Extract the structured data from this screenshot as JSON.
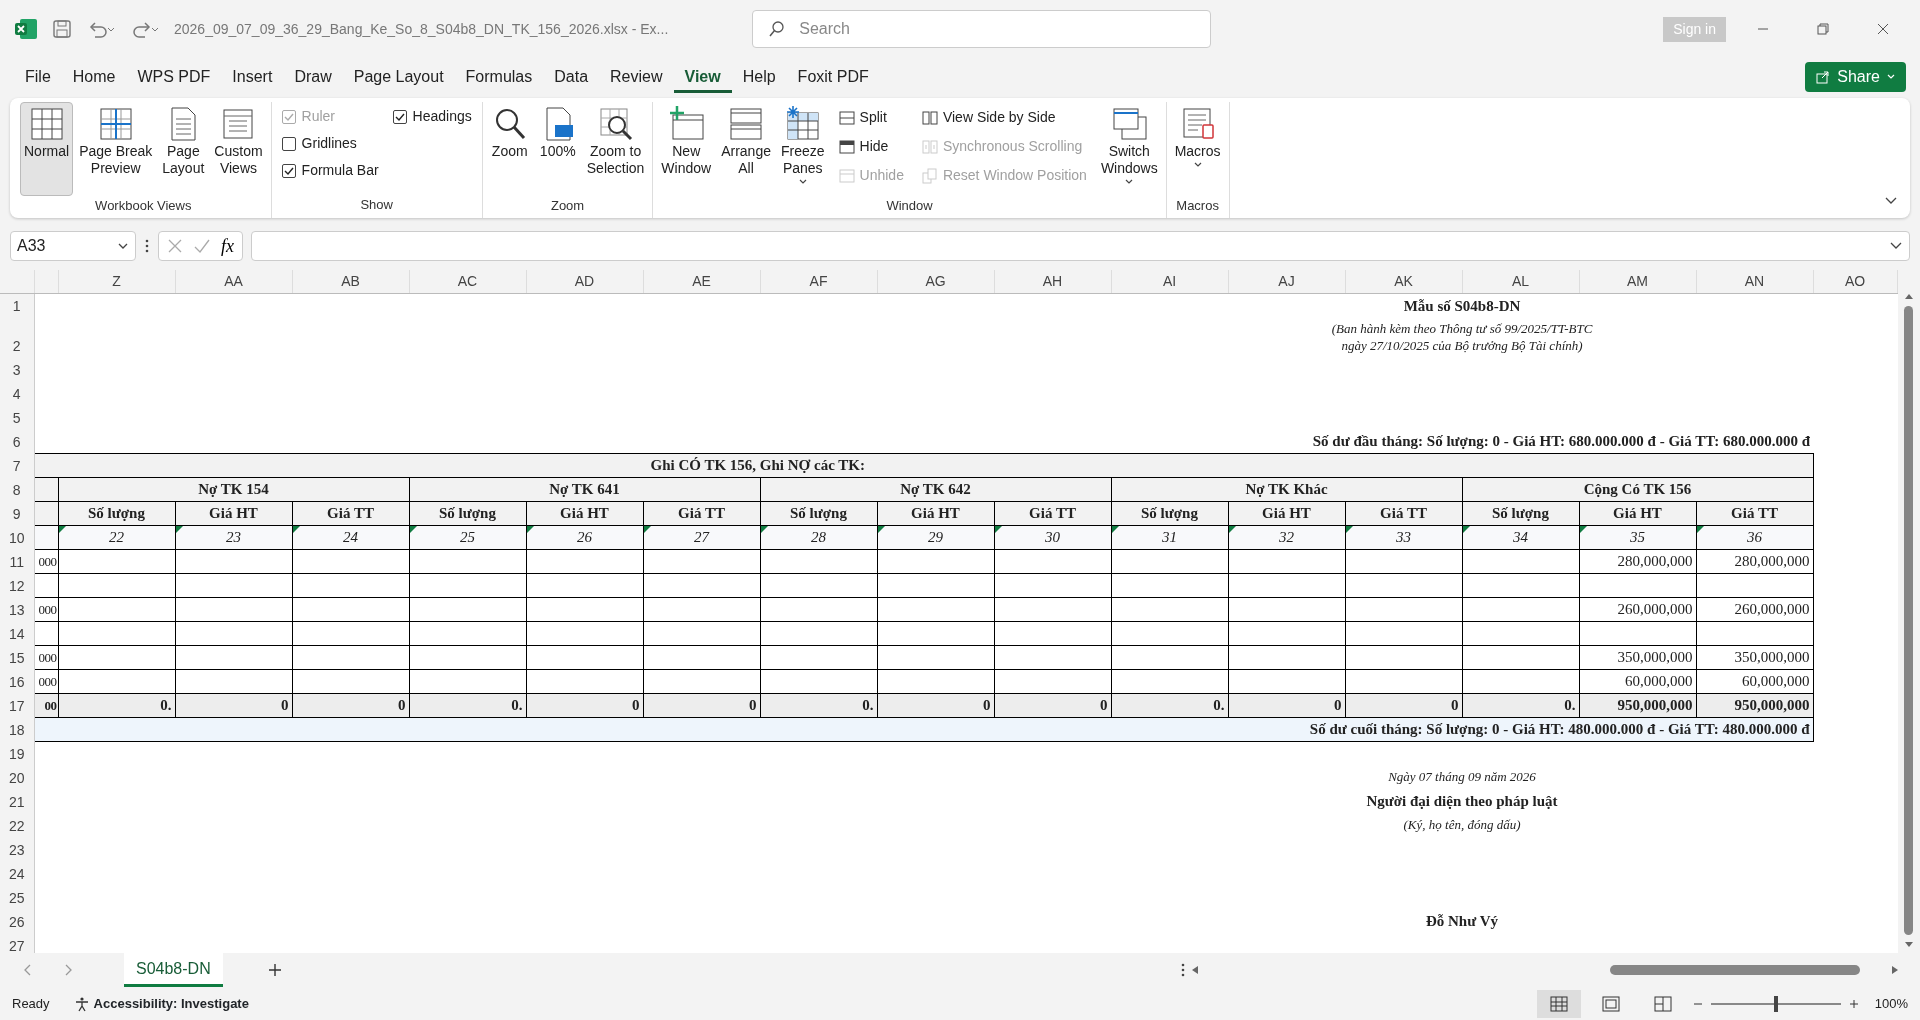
{
  "window": {
    "title": "2026_09_07_09_36_29_Bang_Ke_So_8_S04b8_DN_TK_156_2026.xlsx  -  Ex...",
    "search_placeholder": "Search",
    "sign_in": "Sign in",
    "share": "Share"
  },
  "menu_tabs": [
    {
      "label": "File",
      "selected": false
    },
    {
      "label": "Home",
      "selected": false
    },
    {
      "label": "WPS PDF",
      "selected": false
    },
    {
      "label": "Insert",
      "selected": false
    },
    {
      "label": "Draw",
      "selected": false
    },
    {
      "label": "Page Layout",
      "selected": false
    },
    {
      "label": "Formulas",
      "selected": false
    },
    {
      "label": "Data",
      "selected": false
    },
    {
      "label": "Review",
      "selected": false
    },
    {
      "label": "View",
      "selected": true
    },
    {
      "label": "Help",
      "selected": false
    },
    {
      "label": "Foxit PDF",
      "selected": false
    }
  ],
  "ribbon": [
    {
      "label": "Workbook Views",
      "items": [
        {
          "kind": "large",
          "label": "Normal",
          "selected": true
        },
        {
          "kind": "large",
          "label": "Page Break\nPreview",
          "selected": false
        },
        {
          "kind": "large",
          "label": "Page\nLayout",
          "selected": false
        },
        {
          "kind": "large",
          "label": "Custom\nViews",
          "selected": false
        }
      ]
    },
    {
      "label": "Show",
      "items": [
        {
          "kind": "stack",
          "items": [
            {
              "kind": "checkbox",
              "label": "Ruler",
              "checked": true,
              "disabled": true
            },
            {
              "kind": "checkbox",
              "label": "Gridlines",
              "checked": false,
              "disabled": false
            },
            {
              "kind": "checkbox",
              "label": "Formula Bar",
              "checked": true,
              "disabled": false
            }
          ]
        },
        {
          "kind": "stack",
          "items": [
            {
              "kind": "checkbox",
              "label": "Headings",
              "checked": true,
              "disabled": false
            }
          ]
        }
      ]
    },
    {
      "label": "Zoom",
      "items": [
        {
          "kind": "large",
          "label": "Zoom",
          "selected": false
        },
        {
          "kind": "large",
          "label": "100%",
          "selected": false
        },
        {
          "kind": "large",
          "label": "Zoom to\nSelection",
          "selected": false
        }
      ]
    },
    {
      "label": "Window",
      "items": [
        {
          "kind": "large",
          "label": "New\nWindow",
          "selected": false
        },
        {
          "kind": "large",
          "label": "Arrange\nAll",
          "selected": false
        },
        {
          "kind": "large",
          "label": "Freeze\nPanes",
          "selected": false,
          "dropdown": true
        },
        {
          "kind": "stack",
          "items": [
            {
              "kind": "small",
              "label": "Split",
              "disabled": false
            },
            {
              "kind": "small",
              "label": "Hide",
              "disabled": false
            },
            {
              "kind": "small",
              "label": "Unhide",
              "disabled": true
            }
          ]
        },
        {
          "kind": "stack",
          "items": [
            {
              "kind": "small",
              "label": "View Side by Side",
              "disabled": false
            },
            {
              "kind": "small",
              "label": "Synchronous Scrolling",
              "disabled": true
            },
            {
              "kind": "small",
              "label": "Reset Window Position",
              "disabled": true
            }
          ]
        },
        {
          "kind": "large",
          "label": "Switch\nWindows",
          "selected": false,
          "dropdown": true
        }
      ]
    },
    {
      "label": "Macros",
      "items": [
        {
          "kind": "large",
          "label": "Macros",
          "selected": false,
          "dropdown": true
        }
      ]
    }
  ],
  "formula_bar": {
    "name_box": "A33",
    "function_symbol": "fx"
  },
  "sheet": {
    "columns": [
      "Z",
      "AA",
      "AB",
      "AC",
      "AD",
      "AE",
      "AF",
      "AG",
      "AH",
      "AI",
      "AJ",
      "AK",
      "AL",
      "AM",
      "AN",
      "AO"
    ],
    "row_numbers": [
      "1",
      "2",
      "3",
      "4",
      "5",
      "6",
      "7",
      "8",
      "9",
      "10",
      "11",
      "12",
      "13",
      "14",
      "15",
      "16",
      "17",
      "18",
      "19",
      "20",
      "21",
      "22",
      "23",
      "24",
      "25",
      "26",
      "27"
    ],
    "form": {
      "code": "Mẫu số S04b8-DN",
      "issued_by": "(Ban hành kèm theo Thông tư số 99/2025/TT-BTC",
      "issued_date": "ngày 27/10/2025 của Bộ trưởng Bộ Tài chính)"
    },
    "opening_balance": "Số dư đầu tháng: Số lượng: 0  -  Giá HT: 680.000.000 đ  -  Giá TT: 680.000.000 đ",
    "table": {
      "title": "Ghi CÓ TK 156, Ghi NỢ các TK:",
      "groups": [
        "Nợ TK 154",
        "Nợ TK 641",
        "Nợ TK 642",
        "Nợ TK Khác",
        "Cộng Có TK 156"
      ],
      "subcolumns": [
        "Số lượng",
        "Giá HT",
        "Giá TT",
        "Số lượng",
        "Giá HT",
        "Giá TT",
        "Số lượng",
        "Giá HT",
        "Giá TT",
        "Số lượng",
        "Giá HT",
        "Giá TT",
        "Số lượng",
        "Giá HT",
        "Giá TT"
      ],
      "column_numbers": [
        "22",
        "23",
        "24",
        "25",
        "26",
        "27",
        "28",
        "29",
        "30",
        "31",
        "32",
        "33",
        "34",
        "35",
        "36"
      ],
      "rows": [
        {
          "kind": "data",
          "cut_cell": "000",
          "total_gia_ht": "280,000,000",
          "total_gia_tt": "280,000,000"
        },
        {
          "kind": "data"
        },
        {
          "kind": "data",
          "cut_cell": "000",
          "total_gia_ht": "260,000,000",
          "total_gia_tt": "260,000,000"
        },
        {
          "kind": "data"
        },
        {
          "kind": "data",
          "cut_cell": "000",
          "total_gia_ht": "350,000,000",
          "total_gia_tt": "350,000,000"
        },
        {
          "kind": "data",
          "cut_cell": "000",
          "total_gia_ht": "60,000,000",
          "total_gia_tt": "60,000,000"
        },
        {
          "kind": "total",
          "cut_cell": "00",
          "values": [
            "0.",
            "0",
            "0",
            "0.",
            "0",
            "0",
            "0.",
            "0",
            "0",
            "0.",
            "0",
            "0",
            "0.",
            "950,000,000",
            "950,000,000"
          ]
        }
      ]
    },
    "closing_balance": "Số dư cuối tháng:  Số lượng: 0  -  Giá HT: 480.000.000 đ  -  Giá TT: 480.000.000 đ",
    "signature": {
      "date": "Ngày 07 tháng 09 năm 2026",
      "title": "Người đại diện theo pháp luật",
      "note": "(Ký, họ tên, đóng dấu)",
      "name": "Đỗ Như Vý"
    }
  },
  "sheet_tabs": [
    {
      "label": "S04b8-DN",
      "selected": true
    }
  ],
  "status_bar": {
    "mode": "Ready",
    "accessibility": "Accessibility: Investigate",
    "view_buttons": [
      {
        "selected": true
      },
      {
        "selected": false
      },
      {
        "selected": false
      }
    ],
    "zoom": {
      "level": 0.5,
      "reading": "100%"
    }
  }
}
